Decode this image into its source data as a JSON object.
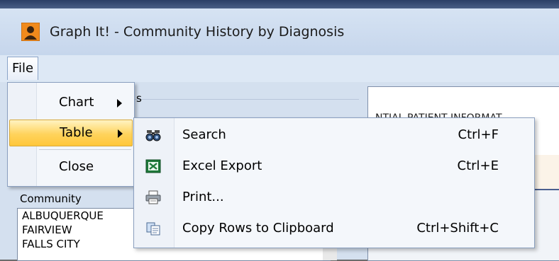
{
  "title_bar": {
    "title": "Graph It! - Community History by Diagnosis"
  },
  "menubar": {
    "file_label": "File"
  },
  "file_menu": {
    "items": [
      {
        "label": "Chart",
        "has_submenu": true
      },
      {
        "label": "Table",
        "has_submenu": true,
        "highlighted": true
      },
      {
        "label": "Close",
        "has_submenu": false
      }
    ]
  },
  "table_submenu": {
    "items": [
      {
        "icon": "binoculars-icon",
        "label": "Search",
        "shortcut": "Ctrl+F"
      },
      {
        "icon": "excel-icon",
        "label": "Excel Export",
        "shortcut": "Ctrl+E"
      },
      {
        "icon": "printer-icon",
        "label": "Print...",
        "shortcut": ""
      },
      {
        "icon": "copy-icon",
        "label": "Copy Rows to Clipboard",
        "shortcut": "Ctrl+Shift+C"
      }
    ]
  },
  "background": {
    "group_label": "s",
    "panel_text": "NTIAL PATIENT INFORMAT",
    "community_label": "Community",
    "communities": [
      "ALBUQUERQUE",
      "FAIRVIEW",
      "FALLS CITY"
    ]
  },
  "colors": {
    "highlight": "#ffd35c",
    "menu_bg": "#f4f7fb",
    "window_bg": "#c9d7ea"
  }
}
